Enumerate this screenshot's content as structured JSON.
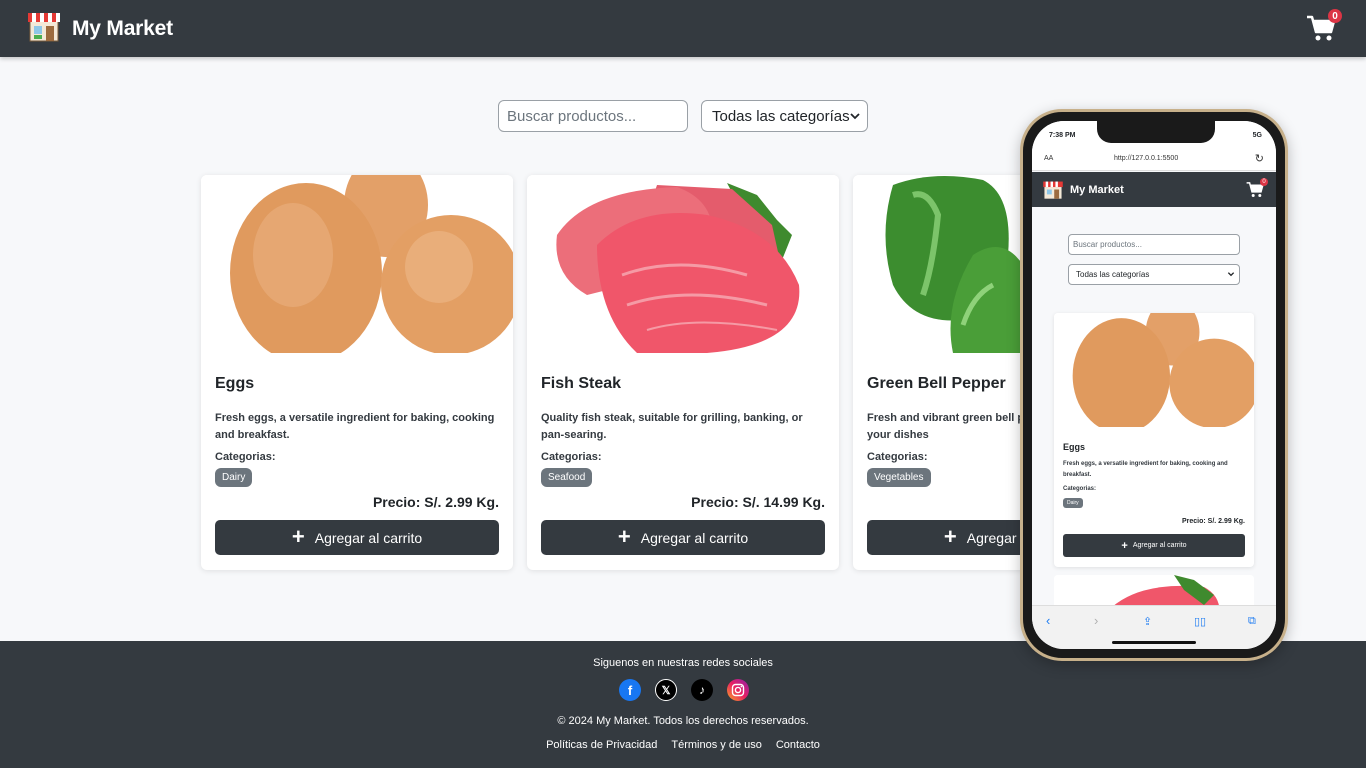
{
  "header": {
    "brand": "My Market",
    "cart_count": "0"
  },
  "filters": {
    "search_placeholder": "Buscar productos...",
    "category_selected": "Todas las categorías"
  },
  "products": [
    {
      "name": "Eggs",
      "description": "Fresh eggs, a versatile ingredient for baking, cooking and breakfast.",
      "categories_label": "Categorias:",
      "category": "Dairy",
      "price": "Precio: S/. 2.99 Kg.",
      "button": "Agregar al carrito"
    },
    {
      "name": "Fish Steak",
      "description": "Quality fish steak, suitable for grilling, banking, or pan-searing.",
      "categories_label": "Categorias:",
      "category": "Seafood",
      "price": "Precio: S/. 14.99 Kg.",
      "button": "Agregar al carrito"
    },
    {
      "name": "Green Bell Pepper",
      "description": "Fresh and vibrant green bell p... color and flavor to your dishes",
      "categories_label": "Categorias:",
      "category": "Vegetables",
      "price": "",
      "button": "Agregar al carrito"
    }
  ],
  "footer": {
    "follow": "Siguenos en nuestras redes sociales",
    "copyright": "© 2024 My Market. Todos los derechos reservados.",
    "links": [
      "Políticas de Privacidad",
      "Términos y de uso",
      "Contacto"
    ]
  },
  "phone": {
    "time": "7:38 PM",
    "network": "5G",
    "url": "http://127.0.0.1:5500",
    "aa": "AA",
    "brand": "My Market",
    "cart_count": "0",
    "search_placeholder": "Buscar productos...",
    "category_selected": "Todas las categorías",
    "product": {
      "name": "Eggs",
      "description": "Fresh eggs, a versatile ingredient for baking, cooking and breakfast.",
      "categories_label": "Categorias:",
      "category": "Dairy",
      "price": "Precio: S/. 2.99 Kg.",
      "button": "Agregar al carrito"
    }
  }
}
